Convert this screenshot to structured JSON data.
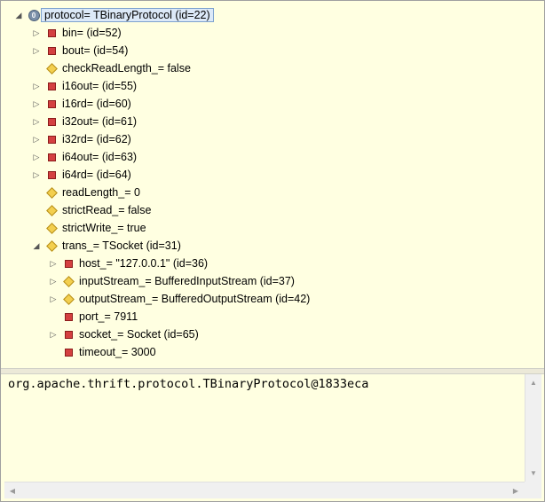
{
  "tree": {
    "root": {
      "label": "protocol= TBinaryProtocol  (id=22)",
      "icon": "object-icon",
      "expanded": true
    },
    "items": [
      {
        "label": "bin=  (id=52)",
        "icon": "private-field-icon",
        "expandable": true,
        "indent": 1
      },
      {
        "label": "bout=  (id=54)",
        "icon": "private-field-icon",
        "expandable": true,
        "indent": 1
      },
      {
        "label": "checkReadLength_= false",
        "icon": "protected-field-icon",
        "expandable": false,
        "indent": 1
      },
      {
        "label": "i16out=  (id=55)",
        "icon": "private-field-icon",
        "expandable": true,
        "indent": 1
      },
      {
        "label": "i16rd=  (id=60)",
        "icon": "private-field-icon",
        "expandable": true,
        "indent": 1
      },
      {
        "label": "i32out=  (id=61)",
        "icon": "private-field-icon",
        "expandable": true,
        "indent": 1
      },
      {
        "label": "i32rd=  (id=62)",
        "icon": "private-field-icon",
        "expandable": true,
        "indent": 1
      },
      {
        "label": "i64out=  (id=63)",
        "icon": "private-field-icon",
        "expandable": true,
        "indent": 1
      },
      {
        "label": "i64rd=  (id=64)",
        "icon": "private-field-icon",
        "expandable": true,
        "indent": 1
      },
      {
        "label": "readLength_= 0",
        "icon": "protected-field-icon",
        "expandable": false,
        "indent": 1
      },
      {
        "label": "strictRead_= false",
        "icon": "protected-field-icon",
        "expandable": false,
        "indent": 1
      },
      {
        "label": "strictWrite_= true",
        "icon": "protected-field-icon",
        "expandable": false,
        "indent": 1
      },
      {
        "label": "trans_= TSocket  (id=31)",
        "icon": "protected-field-icon",
        "expandable": true,
        "expanded": true,
        "indent": 1
      },
      {
        "label": "host_= \"127.0.0.1\" (id=36)",
        "icon": "private-field-icon",
        "expandable": true,
        "indent": 2
      },
      {
        "label": "inputStream_= BufferedInputStream  (id=37)",
        "icon": "protected-field-icon",
        "expandable": true,
        "indent": 2
      },
      {
        "label": "outputStream_= BufferedOutputStream  (id=42)",
        "icon": "protected-field-icon",
        "expandable": true,
        "indent": 2
      },
      {
        "label": "port_= 7911",
        "icon": "private-field-icon",
        "expandable": false,
        "indent": 2
      },
      {
        "label": "socket_= Socket  (id=65)",
        "icon": "private-field-icon",
        "expandable": true,
        "indent": 2
      },
      {
        "label": "timeout_= 3000",
        "icon": "private-field-icon",
        "expandable": false,
        "indent": 2
      }
    ]
  },
  "detail": {
    "text": "org.apache.thrift.protocol.TBinaryProtocol@1833eca"
  },
  "colors": {
    "background": "#ffffe1",
    "private_icon": "#d44040",
    "protected_icon": "#f3cf4e",
    "selection": "#dce9f8"
  }
}
